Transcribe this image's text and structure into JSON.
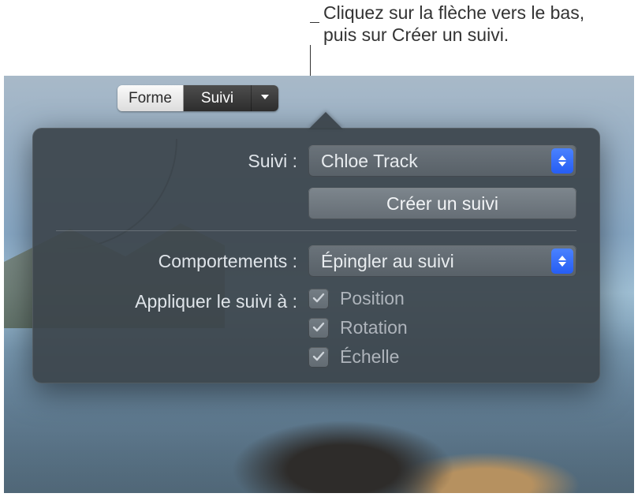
{
  "callout": {
    "text": "Cliquez sur la flèche vers le bas, puis sur Créer un suivi."
  },
  "segmented": {
    "forme": "Forme",
    "suivi": "Suivi"
  },
  "popover": {
    "suivi_label": "Suivi :",
    "suivi_value": "Chloe Track",
    "create_button": "Créer un suivi",
    "behaviors_label": "Comportements :",
    "behaviors_value": "Épingler au suivi",
    "apply_label": "Appliquer le suivi à :",
    "checkboxes": {
      "position": {
        "label": "Position",
        "checked": true
      },
      "rotation": {
        "label": "Rotation",
        "checked": true
      },
      "scale": {
        "label": "Échelle",
        "checked": true
      }
    }
  }
}
